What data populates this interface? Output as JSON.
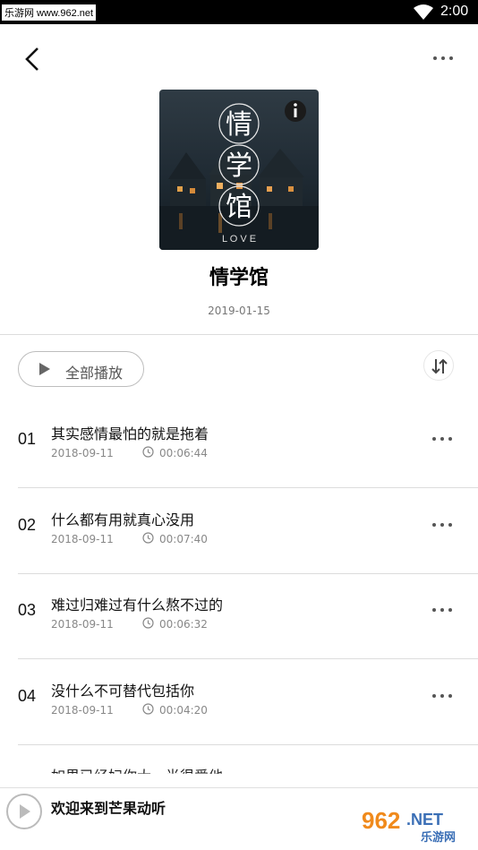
{
  "status_bar": {
    "watermark": "乐游网 www.962.net",
    "time": "2:00"
  },
  "album": {
    "title": "情学馆",
    "date": "2019-01-15",
    "cover_text": [
      "情",
      "学",
      "馆"
    ],
    "cover_subtext": "L O V E"
  },
  "toolbar": {
    "play_all_label": "全部播放"
  },
  "tracks": [
    {
      "num": "01",
      "title": "其实感情最怕的就是拖着",
      "date": "2018-09-11",
      "duration": "00:06:44"
    },
    {
      "num": "02",
      "title": "什么都有用就真心没用",
      "date": "2018-09-11",
      "duration": "00:07:40"
    },
    {
      "num": "03",
      "title": "难过归难过有什么熬不过的",
      "date": "2018-09-11",
      "duration": "00:06:32"
    },
    {
      "num": "04",
      "title": "没什么不可替代包括你",
      "date": "2018-09-11",
      "duration": "00:04:20"
    }
  ],
  "partial_track_title": "如果已经妇你大一半很爱他",
  "mini_player": {
    "text": "欢迎来到芒果动听"
  },
  "watermark_logo": {
    "main": "962",
    "suffix": ".NET",
    "sub": "乐游网"
  },
  "colors": {
    "accent_logo": "#f08a1c",
    "divider": "#dcdcdc"
  }
}
